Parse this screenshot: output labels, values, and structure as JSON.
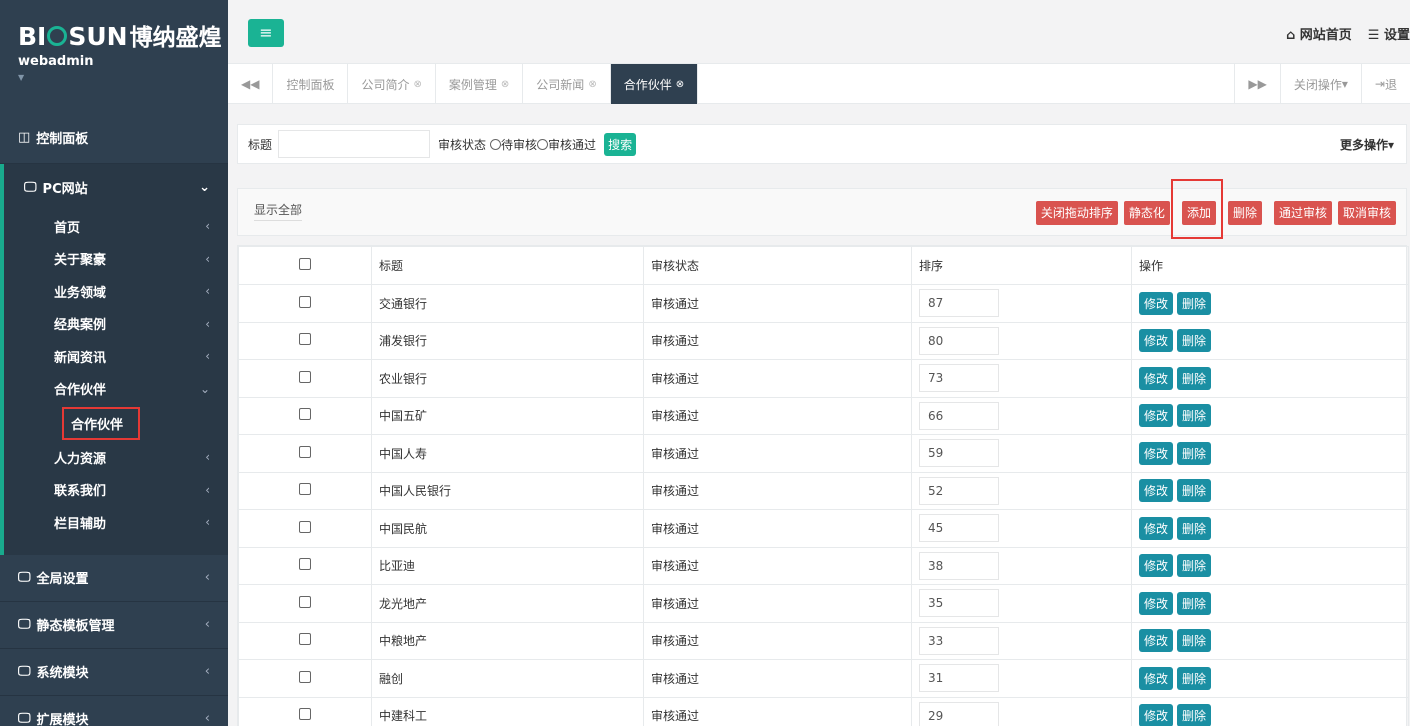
{
  "sidebar": {
    "logo_left": "BI",
    "logo_right": "SUN",
    "logo_cn": "博纳盛煌",
    "username": "webadmin",
    "dashboard": "控制面板",
    "pc_site": "PC网站",
    "pc_items": [
      "首页",
      "关于聚豪",
      "业务领域",
      "经典案例",
      "新闻资讯"
    ],
    "partner_group": "合作伙伴",
    "partner_sub": "合作伙伴",
    "pc_items_after": [
      "人力资源",
      "联系我们",
      "栏目辅助"
    ],
    "bottom_items": [
      "全局设置",
      "静态模板管理",
      "系统模块",
      "扩展模块"
    ]
  },
  "header": {
    "home_link": "网站首页",
    "settings_link": "设置"
  },
  "tabs": {
    "items": [
      "控制面板",
      "公司简介",
      "案例管理",
      "公司新闻"
    ],
    "active": "合作伙伴",
    "close_ops": "关闭操作",
    "logout": "退"
  },
  "search": {
    "title_label": "标题",
    "status_label": "审核状态",
    "option_pending": "待审核",
    "option_approved": "审核通过",
    "search_btn": "搜索",
    "more_ops": "更多操作"
  },
  "actions": {
    "show_all": "显示全部",
    "close_drag_sort": "关闭拖动排序",
    "static": "静态化",
    "add": "添加",
    "delete": "删除",
    "approve": "通过审核",
    "cancel_approve": "取消审核"
  },
  "table": {
    "headers": [
      "标题",
      "审核状态",
      "排序",
      "操作"
    ],
    "edit_label": "修改",
    "delete_label": "删除",
    "rows": [
      {
        "title": "交通银行",
        "status": "审核通过",
        "order": "87"
      },
      {
        "title": "浦发银行",
        "status": "审核通过",
        "order": "80"
      },
      {
        "title": "农业银行",
        "status": "审核通过",
        "order": "73"
      },
      {
        "title": "中国五矿",
        "status": "审核通过",
        "order": "66"
      },
      {
        "title": "中国人寿",
        "status": "审核通过",
        "order": "59"
      },
      {
        "title": "中国人民银行",
        "status": "审核通过",
        "order": "52"
      },
      {
        "title": "中国民航",
        "status": "审核通过",
        "order": "45"
      },
      {
        "title": "比亚迪",
        "status": "审核通过",
        "order": "38"
      },
      {
        "title": "龙光地产",
        "status": "审核通过",
        "order": "35"
      },
      {
        "title": "中粮地产",
        "status": "审核通过",
        "order": "33"
      },
      {
        "title": "融创",
        "status": "审核通过",
        "order": "31"
      },
      {
        "title": "中建科工",
        "status": "审核通过",
        "order": "29"
      }
    ]
  },
  "colors": {
    "sidebar_bg": "#2f4050",
    "accent": "#1ab394",
    "danger": "#d9534f",
    "highlight_box": "#e53935"
  }
}
